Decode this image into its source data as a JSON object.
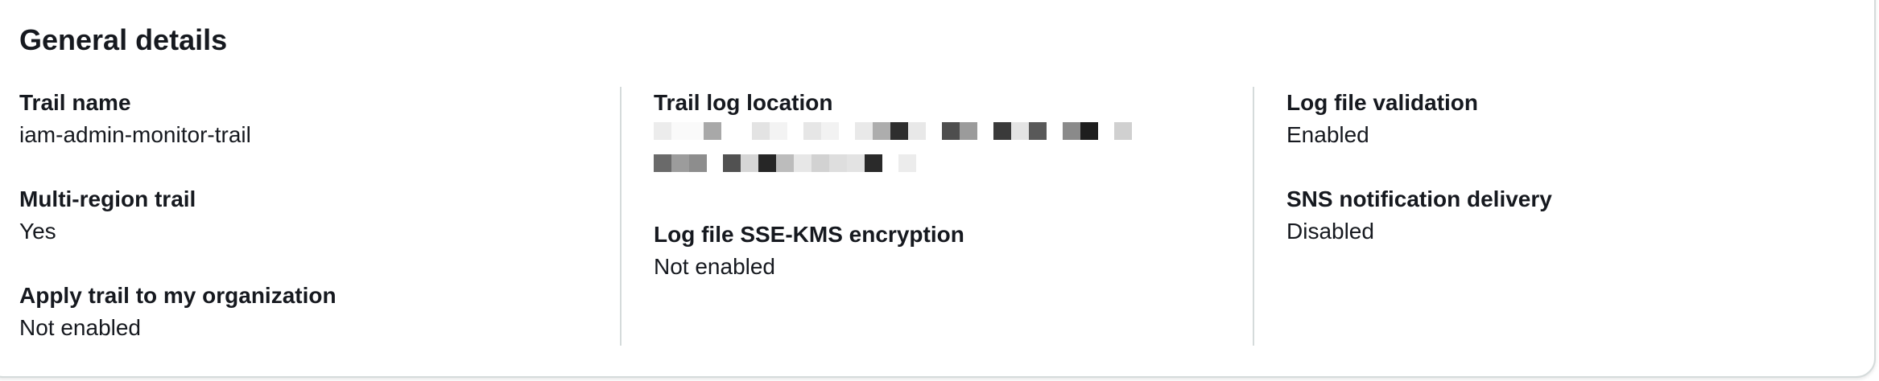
{
  "panel": {
    "title": "General details"
  },
  "column1": {
    "trail_name_label": "Trail name",
    "trail_name_value": "iam-admin-monitor-trail",
    "multi_region_label": "Multi-region trail",
    "multi_region_value": "Yes",
    "apply_org_label": "Apply trail to my organization",
    "apply_org_value": "Not enabled"
  },
  "column2": {
    "log_location_label": "Trail log location",
    "log_location_value_redacted": true,
    "sse_kms_label": "Log file SSE-KMS encryption",
    "sse_kms_value": "Not enabled"
  },
  "column3": {
    "validation_label": "Log file validation",
    "validation_value": "Enabled",
    "sns_label": "SNS notification delivery",
    "sns_value": "Disabled"
  },
  "colors": {
    "text": "#16191f",
    "divider": "#d5dbdb",
    "background": "#ffffff"
  }
}
